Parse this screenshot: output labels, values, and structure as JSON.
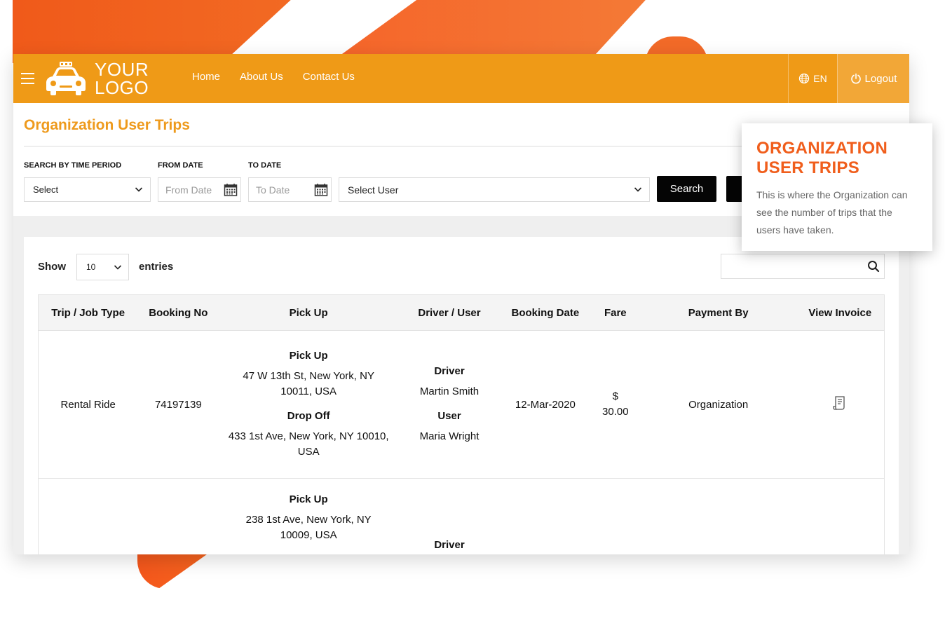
{
  "brand": {
    "logo_line1": "YOUR",
    "logo_line2": "LOGO",
    "accent": "#ef9a17",
    "title_color": "#ee9a1c",
    "callout_color": "#f05e1c"
  },
  "nav": {
    "items": [
      {
        "label": "Home"
      },
      {
        "label": "About Us"
      },
      {
        "label": "Contact Us"
      }
    ]
  },
  "header": {
    "language": "EN",
    "logout_label": "Logout"
  },
  "page": {
    "title": "Organization User Trips"
  },
  "filters": {
    "time_period_label": "SEARCH BY TIME PERIOD",
    "time_period_value": "Select",
    "from_date_label": "FROM DATE",
    "from_date_placeholder": "From Date",
    "to_date_label": "TO DATE",
    "to_date_placeholder": "To Date",
    "user_value": "Select User",
    "search_label": "Search"
  },
  "table_controls": {
    "show_label": "Show",
    "entries_value": "10",
    "entries_label": "entries"
  },
  "table": {
    "headers": [
      "Trip / Job Type",
      "Booking No",
      "Pick Up",
      "Driver / User",
      "Booking Date",
      "Fare",
      "Payment By",
      "View Invoice"
    ],
    "rows": [
      {
        "type": "Rental Ride",
        "booking_no": "74197139",
        "pickup_label": "Pick Up",
        "pickup_addr": "47 W 13th St, New York, NY 10011, USA",
        "dropoff_label": "Drop Off",
        "dropoff_addr": "433 1st Ave, New York, NY 10010, USA",
        "driver_label": "Driver",
        "driver_name": "Martin Smith",
        "user_label": "User",
        "user_name": "Maria Wright",
        "booking_date": "12-Mar-2020",
        "fare_symbol": "$",
        "fare_amount": "30.00",
        "payment_by": "Organization"
      },
      {
        "pickup_label": "Pick Up",
        "pickup_addr": "238 1st Ave, New York, NY 10009, USA",
        "driver_label": "Driver"
      }
    ]
  },
  "callout": {
    "title": "ORGANIZATION USER TRIPS",
    "text": "This is where the Organization can see the number of trips that the users have taken."
  }
}
